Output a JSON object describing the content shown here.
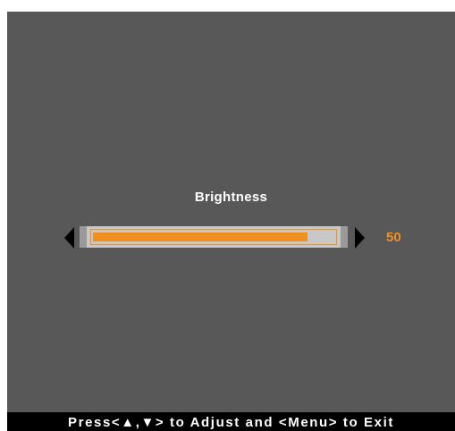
{
  "osd": {
    "title": "Brightness",
    "brightness": {
      "value": 50,
      "display": "50",
      "max": 100
    }
  },
  "footer": {
    "hint": "Press<▲,▼> to Adjust and <Menu> to Exit"
  },
  "colors": {
    "background": "#585858",
    "accent": "#f0901e",
    "track": "#c8c8c8",
    "footer": "#000000"
  },
  "icons": {
    "decrease": "triangle-left-icon",
    "increase": "triangle-right-icon"
  }
}
